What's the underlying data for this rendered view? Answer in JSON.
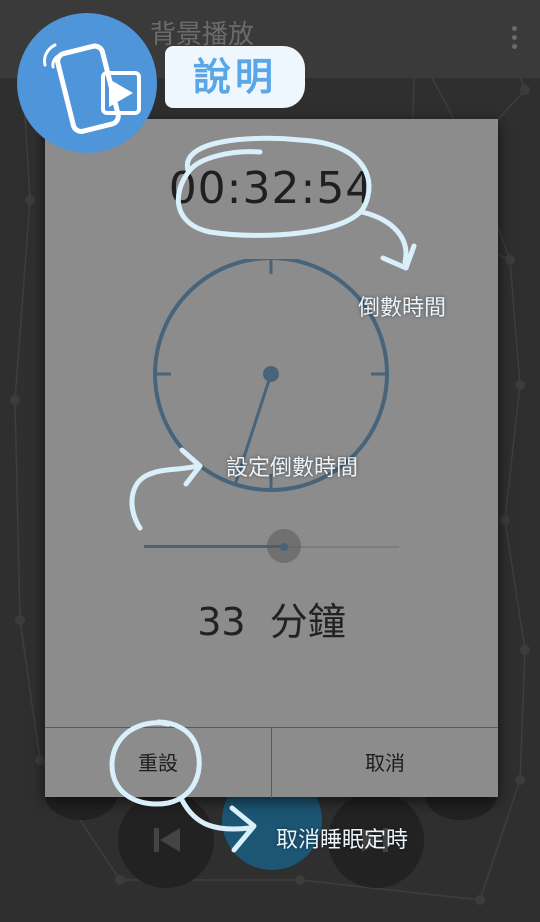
{
  "app_bar": {
    "title": "背景播放"
  },
  "dialog": {
    "countdown": "00:32:54",
    "slider_fraction": 0.55,
    "clock_hand_minutes": 33,
    "minutes_value": "33",
    "minutes_unit": "分鐘",
    "reset_label": "重設",
    "cancel_label": "取消"
  },
  "annotations": {
    "badge_title": "說明",
    "countdown_note": "倒數時間",
    "set_note": "設定倒數時間",
    "cancel_note": "取消睡眠定時"
  },
  "colors": {
    "accent": "#47647a",
    "badge": "#4f95da",
    "annotation_line": "#d9f0fb"
  }
}
